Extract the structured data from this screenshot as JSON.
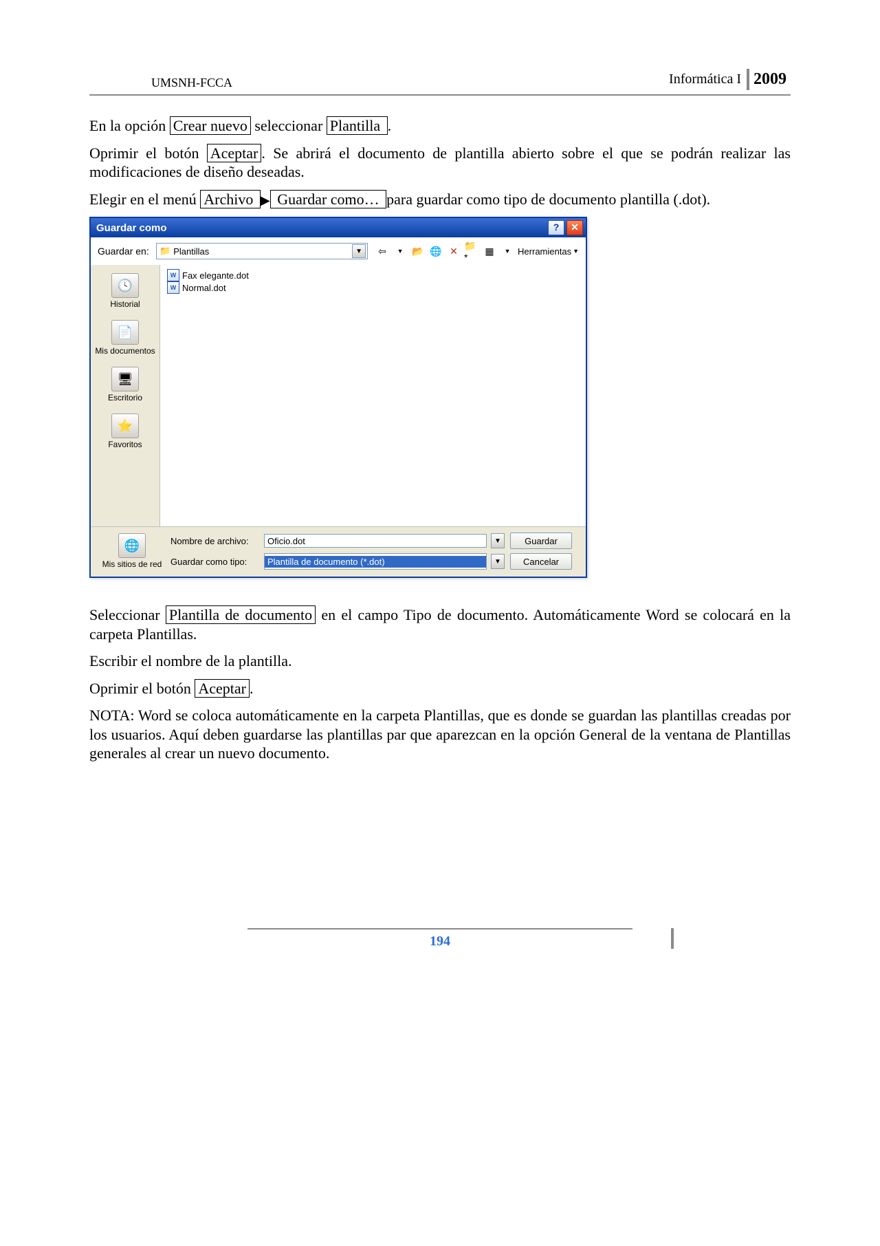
{
  "header": {
    "left": "UMSNH-FCCA",
    "course": "Informática I",
    "year": "2009"
  },
  "body": {
    "p1a": "En la opción ",
    "box1": "Crear nuevo",
    "p1b": " seleccionar ",
    "box2": " Plantilla ",
    "p1c": ".",
    "p2a": "Oprimir el botón ",
    "box3": "Aceptar",
    "p2b": ". Se abrirá el documento de plantilla abierto sobre el que se podrán realizar las modificaciones de diseño deseadas.",
    "p3a": "Elegir en el menú ",
    "box4": " Archivo ",
    "box5": " Guardar como… ",
    "p3b": " para guardar como tipo de documento plantilla (.dot).",
    "p4a": "Seleccionar ",
    "box6": "Plantilla de documento",
    "p4b": " en el campo Tipo de documento. Automáticamente Word se colocará en la carpeta Plantillas.",
    "p5": "Escribir el nombre de la plantilla.",
    "p6a": "Oprimir el botón ",
    "box7": "Aceptar",
    "p6b": ".",
    "p7": "NOTA: Word se coloca automáticamente en la carpeta Plantillas, que es donde se guardan las plantillas creadas por los usuarios. Aquí deben guardarse las plantillas par que aparezcan en la opción General de la ventana de Plantillas generales al crear un nuevo documento."
  },
  "dialog": {
    "title": "Guardar como",
    "saveInLabel": "Guardar en:",
    "saveInValue": "Plantillas",
    "toolsLabel": "Herramientas",
    "sidebar": [
      {
        "label": "Historial"
      },
      {
        "label": "Mis documentos"
      },
      {
        "label": "Escritorio"
      },
      {
        "label": "Favoritos"
      }
    ],
    "files": [
      {
        "name": "Fax elegante.dot"
      },
      {
        "name": "Normal.dot"
      }
    ],
    "netLabel": "Mis sitios de red",
    "fileNameLabel": "Nombre de archivo:",
    "fileNameValue": "Oficio.dot",
    "saveTypeLabel": "Guardar como tipo:",
    "saveTypeValue": "Plantilla de documento (*.dot)",
    "btnSave": "Guardar",
    "btnCancel": "Cancelar"
  },
  "pageNumber": "194"
}
